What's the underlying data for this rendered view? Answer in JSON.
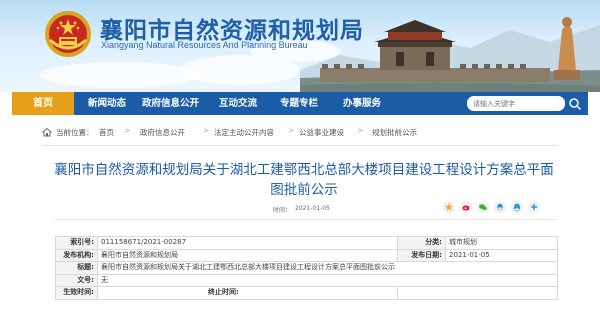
{
  "header": {
    "title": "襄阳市自然资源和规划局",
    "subtitle": "Xiangyang Natural Resources And Planning Bureau"
  },
  "nav": {
    "items": [
      "首页",
      "新闻动态",
      "政府信息公开",
      "互动交流",
      "专题专栏",
      "办事服务"
    ],
    "search_placeholder": "请输入关键字"
  },
  "breadcrumb": {
    "prefix": "当前位置：",
    "items": [
      "首页",
      "政府信息公开",
      "法定主动公开内容",
      "公益事业建设",
      "规划批前公示"
    ]
  },
  "article": {
    "title": "襄阳市自然资源和规划局关于湖北工建鄂西北总部大楼项目建设工程设计方案总平面图批前公示",
    "date_label": "时间：",
    "date": "2021-01-05"
  },
  "info_table": {
    "index_label": "索引号:",
    "index_value": "011158671/2021-00287",
    "category_label": "分类:",
    "category_value": "城市规划",
    "publisher_label": "发布机构:",
    "publisher_value": "襄阳市自然资源和规划局",
    "publish_date_label": "发布日期:",
    "publish_date_value": "2021-01-05",
    "title_label": "标题:",
    "title_value": "襄阳市自然资源和规划局关于湖北工建鄂西北总部大楼项目建设工程设计方案总平面图批前公示",
    "docno_label": "文号:",
    "docno_value": "无",
    "effective_label": "生效时间:",
    "effective_value": "",
    "end_label": "终止时间:",
    "end_value": ""
  },
  "colors": {
    "nav_blue": "#1a5ca6",
    "home_orange": "#e7a019",
    "title_blue": "#1c5aa8"
  }
}
